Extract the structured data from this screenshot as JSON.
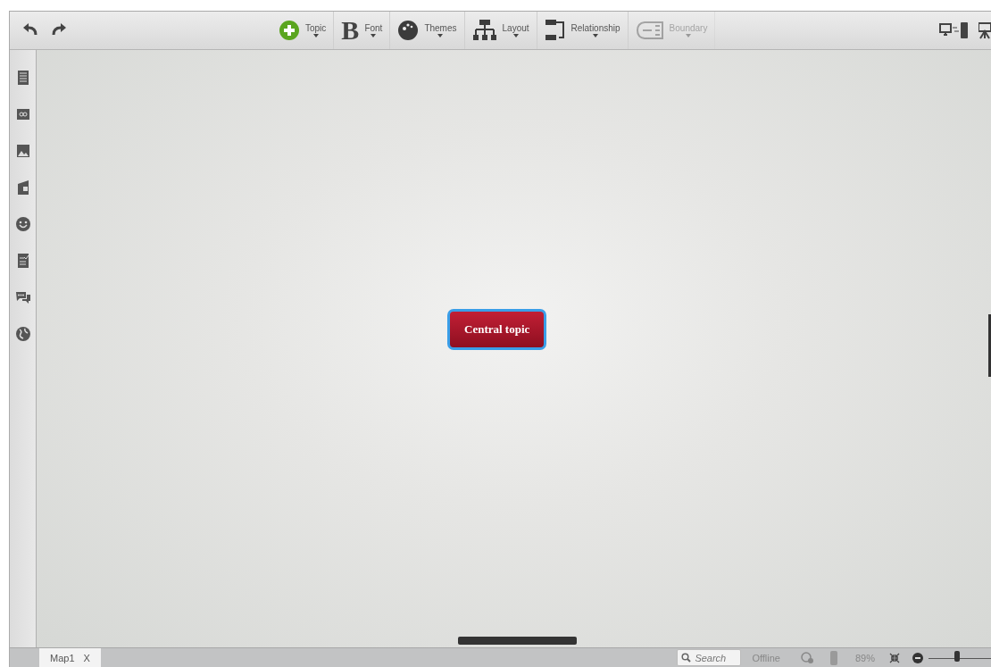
{
  "toolbar": {
    "items": [
      {
        "kind": "topic",
        "label": "Topic",
        "disabled": false
      },
      {
        "kind": "font",
        "label": "Font",
        "glyph": "B",
        "disabled": false
      },
      {
        "kind": "themes",
        "label": "Themes",
        "disabled": false
      },
      {
        "kind": "layout",
        "label": "Layout",
        "disabled": false
      },
      {
        "kind": "relationship",
        "label": "Relationship",
        "disabled": false
      },
      {
        "kind": "boundary",
        "label": "Boundary",
        "disabled": true
      }
    ]
  },
  "sidebar": {
    "items": [
      {
        "kind": "notes"
      },
      {
        "kind": "link"
      },
      {
        "kind": "image"
      },
      {
        "kind": "audio"
      },
      {
        "kind": "emoji"
      },
      {
        "kind": "task"
      },
      {
        "kind": "comment"
      },
      {
        "kind": "globe"
      }
    ]
  },
  "canvas": {
    "central_topic": {
      "label": "Central topic",
      "selected": true
    }
  },
  "tabs": [
    {
      "label": "Map1",
      "close": "X",
      "selected": true
    }
  ],
  "status_bar": {
    "search": {
      "placeholder": "Search"
    },
    "status": "Offline",
    "zoom": "89%",
    "zoom_slider": {
      "level": 0.45
    }
  }
}
